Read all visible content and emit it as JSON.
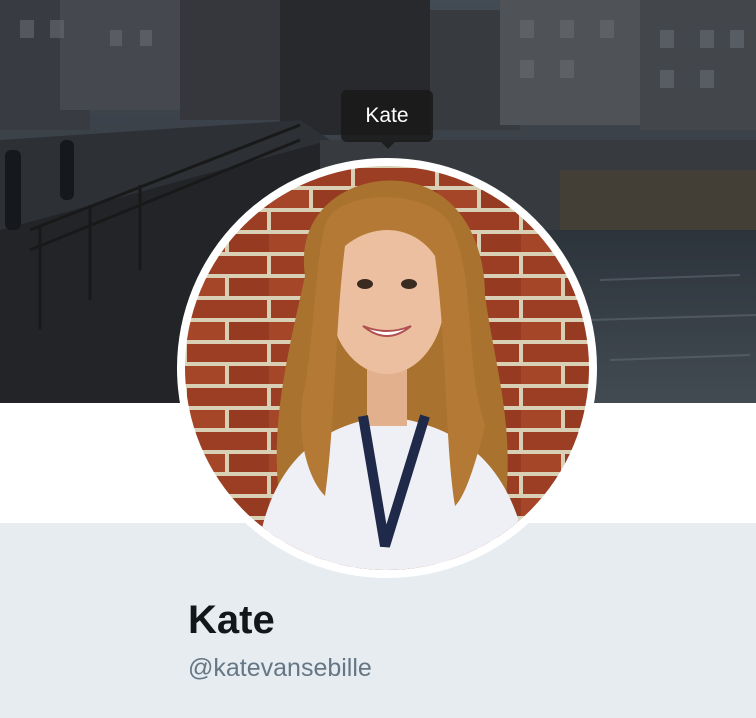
{
  "tooltip": {
    "text": "Kate"
  },
  "profile": {
    "display_name": "Kate",
    "handle": "@katevansebille"
  },
  "icons": {
    "avatar": "profile-photo",
    "banner": "header-photo"
  },
  "colors": {
    "page_background": "#e6ecf0",
    "name_text": "#14171a",
    "handle_text": "#657786"
  }
}
